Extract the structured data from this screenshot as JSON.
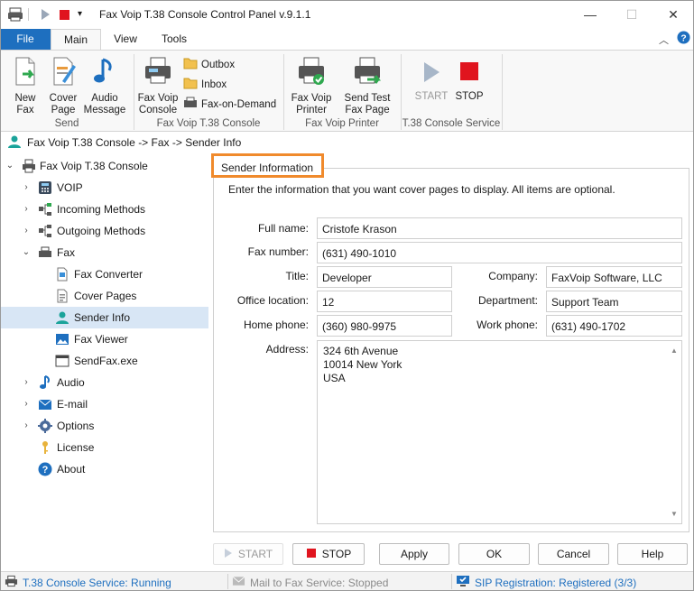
{
  "window": {
    "title": "Fax Voip T.38 Console Control Panel v.9.1.1"
  },
  "ribbon": {
    "tabs": [
      "File",
      "Main",
      "View",
      "Tools"
    ],
    "groups": {
      "send": {
        "name": "Send",
        "new_fax": "New\nFax",
        "cover_page": "Cover\nPage",
        "audio_message": "Audio\nMessage"
      },
      "console": {
        "name": "Fax Voip T.38 Console",
        "fax_voip_console": "Fax Voip\nConsole",
        "outbox": "Outbox",
        "inbox": "Inbox",
        "fax_on_demand": "Fax-on-Demand"
      },
      "printer": {
        "name": "Fax Voip Printer",
        "fax_voip_printer": "Fax Voip\nPrinter",
        "send_test": "Send Test\nFax Page"
      },
      "service": {
        "name": "T.38 Console Service",
        "start": "START",
        "stop": "STOP"
      }
    }
  },
  "breadcrumb": "Fax Voip T.38 Console -> Fax -> Sender Info",
  "tree": {
    "root": "Fax Voip T.38 Console",
    "items": [
      {
        "label": "VOIP"
      },
      {
        "label": "Incoming Methods"
      },
      {
        "label": "Outgoing Methods"
      },
      {
        "label": "Fax"
      },
      {
        "label": "Fax Converter"
      },
      {
        "label": "Cover Pages"
      },
      {
        "label": "Sender Info"
      },
      {
        "label": "Fax Viewer"
      },
      {
        "label": "SendFax.exe"
      },
      {
        "label": "Audio"
      },
      {
        "label": "E-mail"
      },
      {
        "label": "Options"
      },
      {
        "label": "License"
      },
      {
        "label": "About"
      }
    ]
  },
  "panel": {
    "title": "Sender Information",
    "intro": "Enter the information that you want cover pages to display. All items are optional.",
    "fields": {
      "full_name": {
        "label": "Full name:",
        "value": "Cristofe Krason"
      },
      "fax_number": {
        "label": "Fax number:",
        "value": "(631) 490-1010"
      },
      "title": {
        "label": "Title:",
        "value": "Developer"
      },
      "company": {
        "label": "Company:",
        "value": "FaxVoip Software, LLC"
      },
      "office_location": {
        "label": "Office location:",
        "value": "12"
      },
      "department": {
        "label": "Department:",
        "value": "Support Team"
      },
      "home_phone": {
        "label": "Home phone:",
        "value": "(360) 980-9975"
      },
      "work_phone": {
        "label": "Work phone:",
        "value": "(631) 490-1702"
      },
      "address": {
        "label": "Address:",
        "line1": "324 6th Avenue",
        "line2": "10014 New York",
        "line3": "USA"
      }
    }
  },
  "buttons": {
    "start": "START",
    "stop": "STOP",
    "apply": "Apply",
    "ok": "OK",
    "cancel": "Cancel",
    "help": "Help"
  },
  "status": {
    "t38": "T.38 Console Service: Running",
    "mail": "Mail to Fax Service: Stopped",
    "sip": "SIP Registration: Registered (3/3)"
  },
  "colors": {
    "accent": "#1e6fbf",
    "highlight": "#f08a2c",
    "selected": "#d8e6f5",
    "stop_red": "#e0141e"
  }
}
